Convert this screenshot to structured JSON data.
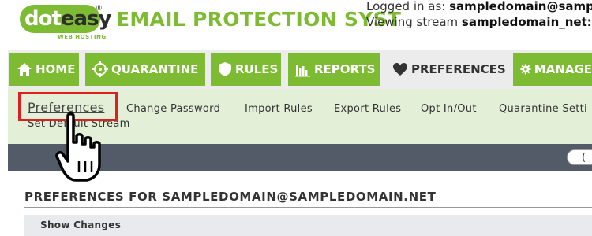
{
  "logo": {
    "part1": "dot",
    "part2": "easy",
    "reg": "®",
    "sub": "WEB HOSTING"
  },
  "header": {
    "title": "EMAIL PROTECTION SYST",
    "login_label": "Logged in as: ",
    "login_user": "sampledomain@samp",
    "stream_label": "Viewing stream ",
    "stream_value": "sampledomain_net:defa"
  },
  "nav": {
    "tabs": [
      {
        "label": "HOME",
        "icon": "home-icon"
      },
      {
        "label": "QUARANTINE",
        "icon": "crosshair-icon"
      },
      {
        "label": "RULES",
        "icon": "shield-icon"
      },
      {
        "label": "REPORTS",
        "icon": "bar-chart-icon"
      },
      {
        "label": "PREFERENCES",
        "icon": "heart-icon",
        "active": true
      },
      {
        "label": "MANAGE",
        "icon": "gear-icon"
      }
    ]
  },
  "subnav": {
    "links": [
      "Preferences",
      "Change Password",
      "Import Rules",
      "Export Rules",
      "Opt In/Out",
      "Quarantine Setti",
      "Set Default Stream"
    ]
  },
  "toolbar": {
    "pill_text": "("
  },
  "main": {
    "title": "PREFERENCES FOR SAMPLEDOMAIN@SAMPLEDOMAIN.NET",
    "show_changes": "Show Changes"
  },
  "colors": {
    "brand_green": "#7dbb33",
    "highlight_red": "#e02020",
    "dark_bar": "#535b69",
    "subnav_bg": "#e3efd6"
  }
}
